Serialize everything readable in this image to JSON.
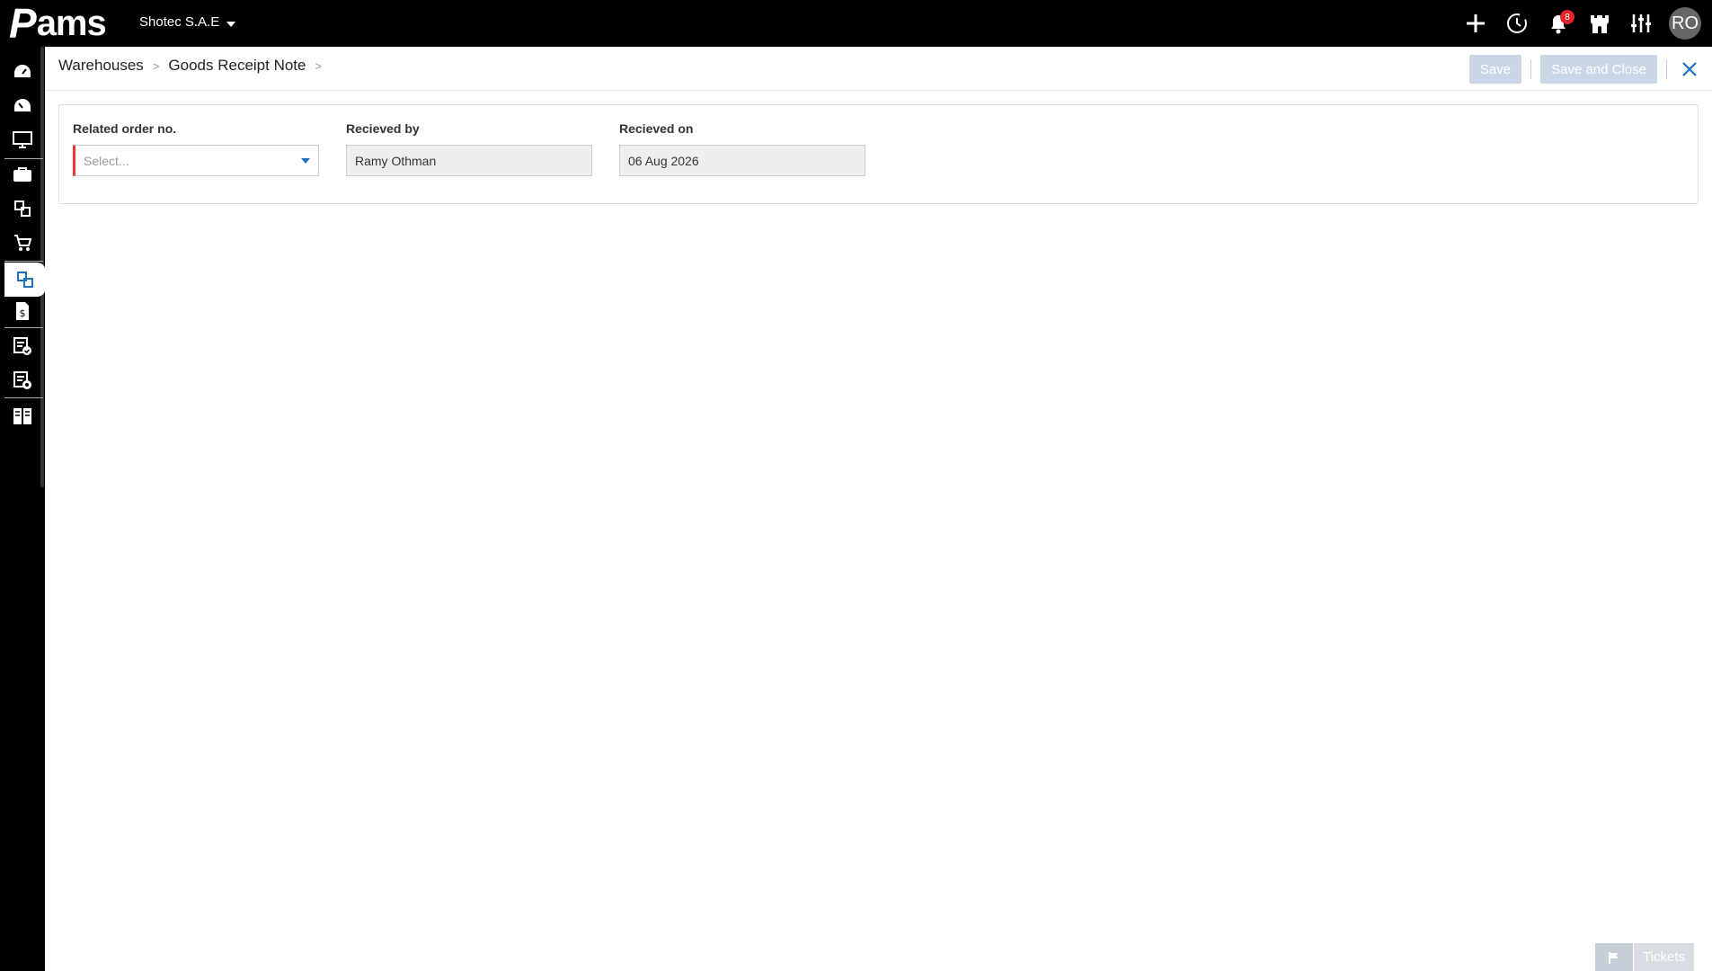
{
  "app": {
    "logo_letter": "P",
    "logo_text": "ams",
    "company": "Shotec S.A.E"
  },
  "topbar": {
    "icons": [
      "plus-icon",
      "history-icon",
      "bell-icon",
      "castle-icon",
      "sliders-icon"
    ],
    "notification_count": "8",
    "avatar_initials": "RO"
  },
  "sidebar": {
    "items": [
      "dashboard-icon",
      "dashboard-alt-icon",
      "monitor-icon",
      "briefcase-icon",
      "modules-icon",
      "cart-icon",
      "warehouse-icon",
      "invoice-icon",
      "checklist-icon",
      "settings-doc-icon",
      "reports-icon"
    ],
    "active_index": 6
  },
  "breadcrumb": {
    "items": [
      "Warehouses",
      "Goods Receipt Note"
    ]
  },
  "actions": {
    "save": "Save",
    "save_close": "Save and Close"
  },
  "form": {
    "related_order": {
      "label": "Related order no.",
      "placeholder": "Select..."
    },
    "received_by": {
      "label": "Recieved by",
      "value": "Ramy  Othman"
    },
    "received_on": {
      "label": "Recieved on",
      "value": "06 Aug 2026"
    }
  },
  "tickets": {
    "label": "Tickets"
  }
}
